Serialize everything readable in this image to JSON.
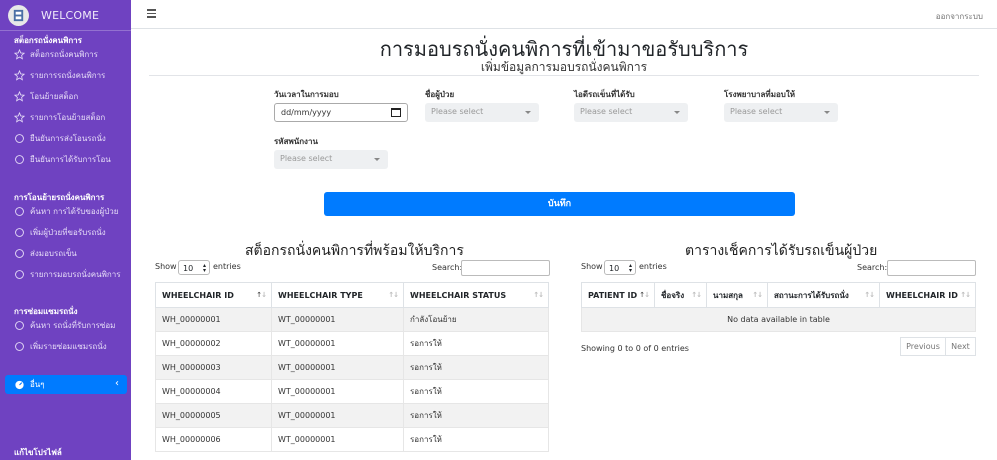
{
  "sidebar": {
    "brand": "WELCOME",
    "sections": [
      {
        "title": "สต็อกรถนั่งคนพิการ",
        "items": [
          "สต็อกรถนั่งคนพิการ",
          "รายการรถนั่งคนพิการ",
          "โอนย้ายสต็อก",
          "รายการโอนย้ายสต็อก",
          "ยืนยันการส่งโอนรถนั่ง",
          "ยืนยันการได้รับการโอน"
        ]
      },
      {
        "title": "การโอนย้ายรถนั่งคนพิการ",
        "items": [
          "ค้นหา การได้รับของผู้ป่วย",
          "เพิ่มผู้ป่วยที่ขอรับรถนั่ง",
          "ส่งมอบรถเข็น",
          "รายการมอบรถนั่งคนพิการ"
        ]
      },
      {
        "title": "การซ่อมแซมรถนั่ง",
        "items": [
          "ค้นหา รถนั่งที่รับการซ่อม",
          "เพิ่มรายซ่อมแซมรถนั่ง"
        ]
      }
    ],
    "active_item": "อื่นๆ",
    "profile": "แก้ไขโปรไฟล์"
  },
  "topbar": {
    "logout": "ออกจากระบบ"
  },
  "page": {
    "title": "การมอบรถนั่งคนพิการที่เข้ามาขอรับบริการ",
    "subtitle": "เพิ่มข้อมูลการมอบรถนั่งคนพิการ"
  },
  "form": {
    "date_label": "วันเวลาในการมอบ",
    "date_value": "dd/mm/yyyy",
    "patient_label": "ชื่อผู้ป่วย",
    "wheelchair_id_label": "ไอดีรถเข็นที่ได้รับ",
    "hospital_label": "โรงพยาบาลที่มอบให้",
    "employee_label": "รหัสพนักงาน",
    "select_placeholder": "Please select",
    "submit": "บันทึก"
  },
  "stock_table": {
    "title": "สต็อกรถนั่งคนพิการที่พร้อมให้บริการ",
    "show": "Show",
    "length": "10",
    "entries": "entries",
    "search": "Search:",
    "columns": [
      "WHEELCHAIR ID",
      "WHEELCHAIR TYPE",
      "WHEELCHAIR STATUS"
    ],
    "rows": [
      [
        "WH_00000001",
        "WT_00000001",
        "กำลังโอนย้าย"
      ],
      [
        "WH_00000002",
        "WT_00000001",
        "รอการให้"
      ],
      [
        "WH_00000003",
        "WT_00000001",
        "รอการให้"
      ],
      [
        "WH_00000004",
        "WT_00000001",
        "รอการให้"
      ],
      [
        "WH_00000005",
        "WT_00000001",
        "รอการให้"
      ],
      [
        "WH_00000006",
        "WT_00000001",
        "รอการให้"
      ]
    ]
  },
  "check_table": {
    "title": "ตารางเช็คการได้รับรถเข็นผู้ป่วย",
    "show": "Show",
    "length": "10",
    "entries": "entries",
    "search": "Search:",
    "columns": [
      "PATIENT ID",
      "ชื่อจริง",
      "นามสกุล",
      "สถานะการได้รับรถนั่ง",
      "WHEELCHAIR ID"
    ],
    "empty": "No data available in table",
    "info": "Showing 0 to 0 of 0 entries",
    "previous": "Previous",
    "next": "Next"
  },
  "colors": {
    "sidebar": "#6f42c1",
    "primary": "#007bff"
  }
}
